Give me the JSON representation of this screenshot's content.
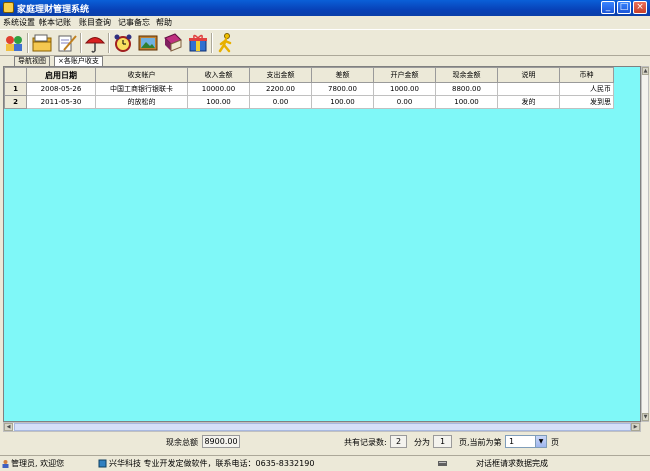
{
  "window": {
    "title": "家庭理财管理系统"
  },
  "menu": [
    "系统设置",
    "帐本记账",
    "账目查询",
    "记事备忘",
    "帮助"
  ],
  "toolbar": {
    "icons": [
      "people-icon",
      "folder-icon",
      "write-icon",
      "umbrella-icon",
      "alarm-clock-icon",
      "picture-icon",
      "book-icon",
      "gift-icon",
      "walker-icon"
    ]
  },
  "tabs": [
    {
      "label": "导航视图"
    },
    {
      "label": "各账户收支",
      "close": "×"
    }
  ],
  "table": {
    "columns": [
      "启用日期",
      "收支帐户",
      "收入金额",
      "支出金额",
      "差额",
      "开户金额",
      "现余金额",
      "说明",
      "币种"
    ],
    "rows": [
      {
        "num": "1",
        "cells": [
          "2008-05-26",
          "中国工商银行银联卡",
          "10000.00",
          "2200.00",
          "7800.00",
          "1000.00",
          "8800.00",
          "",
          "人民币"
        ]
      },
      {
        "num": "2",
        "cells": [
          "2011-05-30",
          "的放松的",
          "100.00",
          "0.00",
          "100.00",
          "0.00",
          "100.00",
          "发的",
          "发到思"
        ]
      }
    ]
  },
  "footer": {
    "balance_label": "现余总额",
    "balance_value": "8900.00",
    "records_label": "共有记录数:",
    "records_value": "2",
    "pages_label": "分为",
    "pages_value": "1",
    "current_label": "页,当前为第",
    "current_value": "1",
    "page_suffix": "页"
  },
  "status": {
    "user": "管理员, 欢迎您",
    "company": "兴华科技  专业开发定做软件，联系电话：0635-8332190",
    "message": "对话框请求数据完成"
  }
}
